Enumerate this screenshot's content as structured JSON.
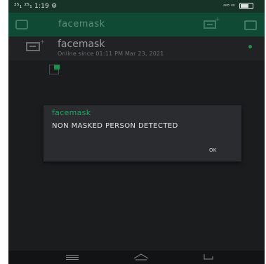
{
  "status_bar": {
    "left_text": "²⁵₁ ²⁵₁ 1:19 ⚙",
    "right_text": "ᴬᴷᴮ ᴷᴷ",
    "battery_level": 0.75
  },
  "toolbar": {
    "title": "facemask",
    "left_icon": "device-frame-icon",
    "add_device_icon": "add-device-icon",
    "right_icon": "window-icon"
  },
  "device_row": {
    "title": "facemask",
    "subtitle": "Online since 01:11 PM Mar 23, 2021",
    "status_color": "#1f8f4e"
  },
  "dialog": {
    "title": "facemask",
    "message": "NON MASKED PERSON DETECTED",
    "ok_label": "OK",
    "title_color": "#20a565"
  },
  "navbar": {
    "menu_icon": "menu-icon",
    "home_icon": "home-icon",
    "back_icon": "back-icon"
  },
  "colors": {
    "accent": "#20a565",
    "toolbar_bg": "#0f4a34",
    "screen_bg": "#1b1c1e"
  }
}
